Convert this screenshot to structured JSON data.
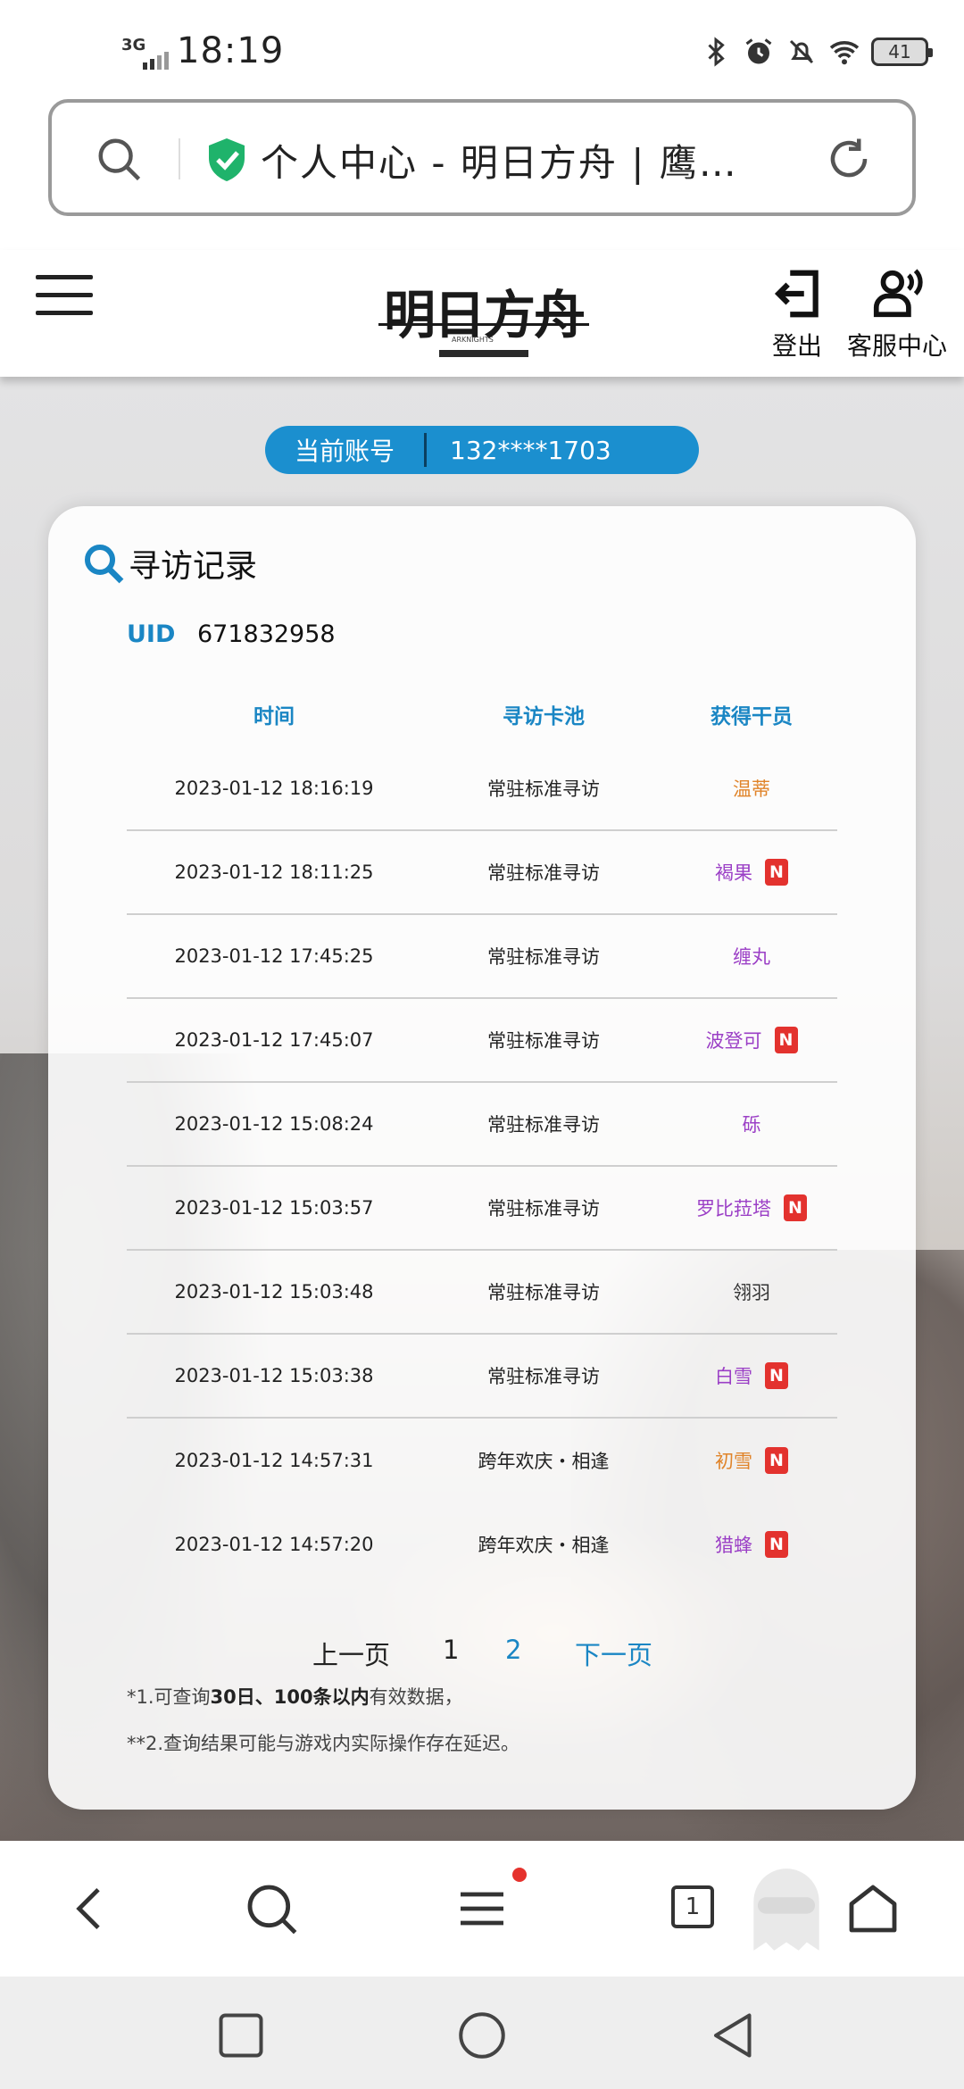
{
  "status_bar": {
    "network": "3G",
    "time": "18:19",
    "battery": "41"
  },
  "url_bar": {
    "title": "个人中心 - 明日方舟 | 鹰…"
  },
  "site_header": {
    "logo_text": "明日方舟",
    "logo_sub": "ARKNIGHTS",
    "logout_label": "登出",
    "service_label": "客服中心"
  },
  "account": {
    "label": "当前账号",
    "value": "132****1703"
  },
  "records": {
    "title": "寻访记录",
    "uid_label": "UID",
    "uid_value": "671832958",
    "columns": [
      "时间",
      "寻访卡池",
      "获得干员"
    ],
    "rows": [
      {
        "time": "2023-01-12 18:16:19",
        "pool": "常驻标准寻访",
        "operator": "温蒂",
        "color": "#e0842a",
        "new": false
      },
      {
        "time": "2023-01-12 18:11:25",
        "pool": "常驻标准寻访",
        "operator": "褐果",
        "color": "#9b3fc6",
        "new": true
      },
      {
        "time": "2023-01-12 17:45:25",
        "pool": "常驻标准寻访",
        "operator": "缠丸",
        "color": "#9b3fc6",
        "new": false
      },
      {
        "time": "2023-01-12 17:45:07",
        "pool": "常驻标准寻访",
        "operator": "波登可",
        "color": "#9b3fc6",
        "new": true
      },
      {
        "time": "2023-01-12 15:08:24",
        "pool": "常驻标准寻访",
        "operator": "砾",
        "color": "#9b3fc6",
        "new": false
      },
      {
        "time": "2023-01-12 15:03:57",
        "pool": "常驻标准寻访",
        "operator": "罗比菈塔",
        "color": "#9b3fc6",
        "new": true
      },
      {
        "time": "2023-01-12 15:03:48",
        "pool": "常驻标准寻访",
        "operator": "翎羽",
        "color": "#333333",
        "new": false
      },
      {
        "time": "2023-01-12 15:03:38",
        "pool": "常驻标准寻访",
        "operator": "白雪",
        "color": "#9b3fc6",
        "new": true
      },
      {
        "time": "2023-01-12 14:57:31",
        "pool": "跨年欢庆・相逢",
        "operator": "初雪",
        "color": "#e0842a",
        "new": true
      },
      {
        "time": "2023-01-12 14:57:20",
        "pool": "跨年欢庆・相逢",
        "operator": "猎蜂",
        "color": "#9b3fc6",
        "new": true
      }
    ],
    "new_badge": "N",
    "pager": {
      "prev": "上一页",
      "page1": "1",
      "page2": "2",
      "next": "下一页"
    },
    "note1_prefix": "*1.可查询",
    "note1_bold": "30日、100条以内",
    "note1_suffix": "有效数据，",
    "note2": "**2.查询结果可能与游戏内实际操作存在延迟。"
  },
  "toolbar": {
    "tab_count": "1"
  },
  "colors": {
    "accent": "#1a86c4",
    "pill": "#1b8fcf",
    "badge": "#e3322e"
  }
}
